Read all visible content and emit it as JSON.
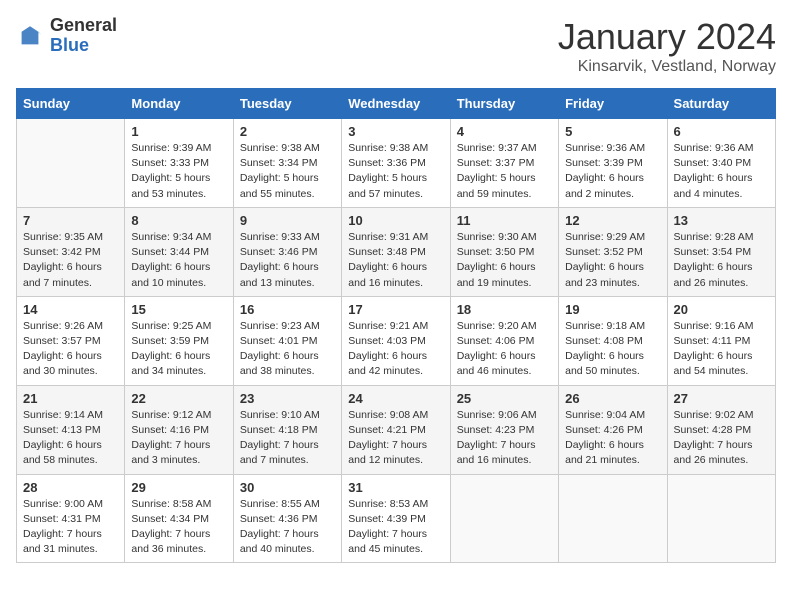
{
  "header": {
    "logo_general": "General",
    "logo_blue": "Blue",
    "month_year": "January 2024",
    "location": "Kinsarvik, Vestland, Norway"
  },
  "days_of_week": [
    "Sunday",
    "Monday",
    "Tuesday",
    "Wednesday",
    "Thursday",
    "Friday",
    "Saturday"
  ],
  "weeks": [
    [
      {
        "day": "",
        "info": ""
      },
      {
        "day": "1",
        "info": "Sunrise: 9:39 AM\nSunset: 3:33 PM\nDaylight: 5 hours\nand 53 minutes."
      },
      {
        "day": "2",
        "info": "Sunrise: 9:38 AM\nSunset: 3:34 PM\nDaylight: 5 hours\nand 55 minutes."
      },
      {
        "day": "3",
        "info": "Sunrise: 9:38 AM\nSunset: 3:36 PM\nDaylight: 5 hours\nand 57 minutes."
      },
      {
        "day": "4",
        "info": "Sunrise: 9:37 AM\nSunset: 3:37 PM\nDaylight: 5 hours\nand 59 minutes."
      },
      {
        "day": "5",
        "info": "Sunrise: 9:36 AM\nSunset: 3:39 PM\nDaylight: 6 hours\nand 2 minutes."
      },
      {
        "day": "6",
        "info": "Sunrise: 9:36 AM\nSunset: 3:40 PM\nDaylight: 6 hours\nand 4 minutes."
      }
    ],
    [
      {
        "day": "7",
        "info": "Sunrise: 9:35 AM\nSunset: 3:42 PM\nDaylight: 6 hours\nand 7 minutes."
      },
      {
        "day": "8",
        "info": "Sunrise: 9:34 AM\nSunset: 3:44 PM\nDaylight: 6 hours\nand 10 minutes."
      },
      {
        "day": "9",
        "info": "Sunrise: 9:33 AM\nSunset: 3:46 PM\nDaylight: 6 hours\nand 13 minutes."
      },
      {
        "day": "10",
        "info": "Sunrise: 9:31 AM\nSunset: 3:48 PM\nDaylight: 6 hours\nand 16 minutes."
      },
      {
        "day": "11",
        "info": "Sunrise: 9:30 AM\nSunset: 3:50 PM\nDaylight: 6 hours\nand 19 minutes."
      },
      {
        "day": "12",
        "info": "Sunrise: 9:29 AM\nSunset: 3:52 PM\nDaylight: 6 hours\nand 23 minutes."
      },
      {
        "day": "13",
        "info": "Sunrise: 9:28 AM\nSunset: 3:54 PM\nDaylight: 6 hours\nand 26 minutes."
      }
    ],
    [
      {
        "day": "14",
        "info": "Sunrise: 9:26 AM\nSunset: 3:57 PM\nDaylight: 6 hours\nand 30 minutes."
      },
      {
        "day": "15",
        "info": "Sunrise: 9:25 AM\nSunset: 3:59 PM\nDaylight: 6 hours\nand 34 minutes."
      },
      {
        "day": "16",
        "info": "Sunrise: 9:23 AM\nSunset: 4:01 PM\nDaylight: 6 hours\nand 38 minutes."
      },
      {
        "day": "17",
        "info": "Sunrise: 9:21 AM\nSunset: 4:03 PM\nDaylight: 6 hours\nand 42 minutes."
      },
      {
        "day": "18",
        "info": "Sunrise: 9:20 AM\nSunset: 4:06 PM\nDaylight: 6 hours\nand 46 minutes."
      },
      {
        "day": "19",
        "info": "Sunrise: 9:18 AM\nSunset: 4:08 PM\nDaylight: 6 hours\nand 50 minutes."
      },
      {
        "day": "20",
        "info": "Sunrise: 9:16 AM\nSunset: 4:11 PM\nDaylight: 6 hours\nand 54 minutes."
      }
    ],
    [
      {
        "day": "21",
        "info": "Sunrise: 9:14 AM\nSunset: 4:13 PM\nDaylight: 6 hours\nand 58 minutes."
      },
      {
        "day": "22",
        "info": "Sunrise: 9:12 AM\nSunset: 4:16 PM\nDaylight: 7 hours\nand 3 minutes."
      },
      {
        "day": "23",
        "info": "Sunrise: 9:10 AM\nSunset: 4:18 PM\nDaylight: 7 hours\nand 7 minutes."
      },
      {
        "day": "24",
        "info": "Sunrise: 9:08 AM\nSunset: 4:21 PM\nDaylight: 7 hours\nand 12 minutes."
      },
      {
        "day": "25",
        "info": "Sunrise: 9:06 AM\nSunset: 4:23 PM\nDaylight: 7 hours\nand 16 minutes."
      },
      {
        "day": "26",
        "info": "Sunrise: 9:04 AM\nSunset: 4:26 PM\nDaylight: 6 hours\nand 21 minutes."
      },
      {
        "day": "27",
        "info": "Sunrise: 9:02 AM\nSunset: 4:28 PM\nDaylight: 7 hours\nand 26 minutes."
      }
    ],
    [
      {
        "day": "28",
        "info": "Sunrise: 9:00 AM\nSunset: 4:31 PM\nDaylight: 7 hours\nand 31 minutes."
      },
      {
        "day": "29",
        "info": "Sunrise: 8:58 AM\nSunset: 4:34 PM\nDaylight: 7 hours\nand 36 minutes."
      },
      {
        "day": "30",
        "info": "Sunrise: 8:55 AM\nSunset: 4:36 PM\nDaylight: 7 hours\nand 40 minutes."
      },
      {
        "day": "31",
        "info": "Sunrise: 8:53 AM\nSunset: 4:39 PM\nDaylight: 7 hours\nand 45 minutes."
      },
      {
        "day": "",
        "info": ""
      },
      {
        "day": "",
        "info": ""
      },
      {
        "day": "",
        "info": ""
      }
    ]
  ]
}
